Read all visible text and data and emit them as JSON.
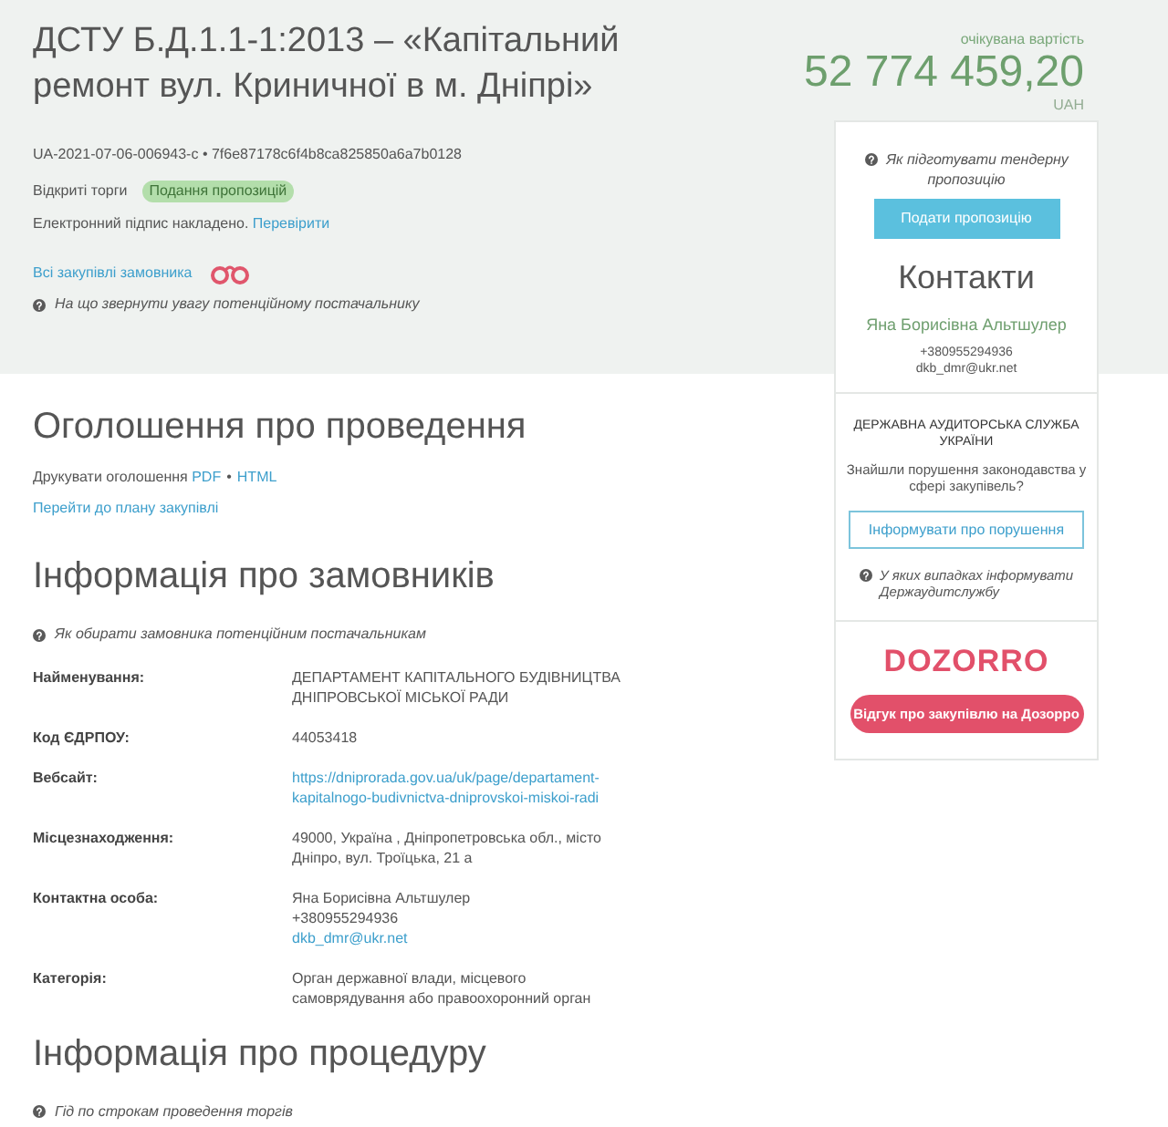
{
  "header": {
    "title": "ДСТУ Б.Д.1.1-1:2013 – «Капітальний ремонт вул. Криничної в м. Дніпрі»",
    "identifier": "UA-2021-07-06-006943-c • 7f6e87178c6f4b8ca825850a6a7b0128",
    "procedure_type": "Відкриті торги",
    "status": "Подання пропозицій",
    "signature": {
      "text": "Електронний підпис накладено.",
      "link": "Перевірити"
    },
    "buyer_link": "Всі закупівлі замовника",
    "hint": "На що звернути увагу потенційному постачальнику"
  },
  "price": {
    "caption": "очікувана вартість",
    "amount": "52 774 459,20",
    "currency": "UAH"
  },
  "side_panel": {
    "hint": "Як підготувати тендерну пропозицію",
    "submit_button": "Подати пропозицію",
    "contacts": {
      "title": "Контакти",
      "name": "Яна Борисівна Альтшулер",
      "phone": "+380955294936",
      "email": "dkb_dmr@ukr.net"
    },
    "audit": {
      "title": "ДЕРЖАВНА АУДИТОРСЬКА СЛУЖБА УКРАЇНИ",
      "question": "Знайшли порушення законодавства у сфері закупівель?",
      "button": "Інформувати про порушення",
      "hint": "У яких випадках інформувати Держаудитслужбу"
    },
    "review": {
      "logo": "DOZORRO",
      "button": "Відгук про закупівлю на Дозорро"
    }
  },
  "announcement": {
    "title": "Оголошення про проведення",
    "print_label": "Друкувати оголошення",
    "print_links": [
      "PDF",
      "HTML"
    ],
    "separator": "•",
    "plan_link": "Перейти до плану закупівлі"
  },
  "buyers": {
    "title": "Інформація про замовників",
    "hint": "Як обирати замовника потенційним постачальникам",
    "rows": [
      {
        "label": "Найменування:",
        "values": [
          {
            "kind": "text",
            "text": "ДЕПАРТАМЕНТ КАПІТАЛЬНОГО БУДІВНИЦТВА ДНІПРОВСЬКОЇ МІСЬКОЇ РАДИ"
          }
        ]
      },
      {
        "label": "Код ЄДРПОУ:",
        "values": [
          {
            "kind": "text",
            "text": "44053418"
          }
        ]
      },
      {
        "label": "Вебсайт:",
        "values": [
          {
            "kind": "link",
            "text": "https://dniprorada.gov.ua/uk/page/departament-kapitalnogo-budivnictva-dniprovskoi-miskoi-radi"
          }
        ]
      },
      {
        "label": "Місцезнаходження:",
        "values": [
          {
            "kind": "text",
            "text": "49000, Україна , Дніпропетровська обл., місто Дніпро, вул. Троїцька, 21 а"
          }
        ]
      },
      {
        "label": "Контактна особа:",
        "values": [
          {
            "kind": "text",
            "text": "Яна Борисівна Альтшулер"
          },
          {
            "kind": "text",
            "text": "+380955294936"
          },
          {
            "kind": "link",
            "text": "dkb_dmr@ukr.net"
          }
        ]
      },
      {
        "label": "Категорія:",
        "values": [
          {
            "kind": "text",
            "text": "Орган державної влади, місцевого самоврядування або правоохоронний орган"
          }
        ]
      }
    ]
  },
  "procedure": {
    "title": "Інформація про процедуру",
    "hint": "Гід по строкам проведення торгів"
  }
}
